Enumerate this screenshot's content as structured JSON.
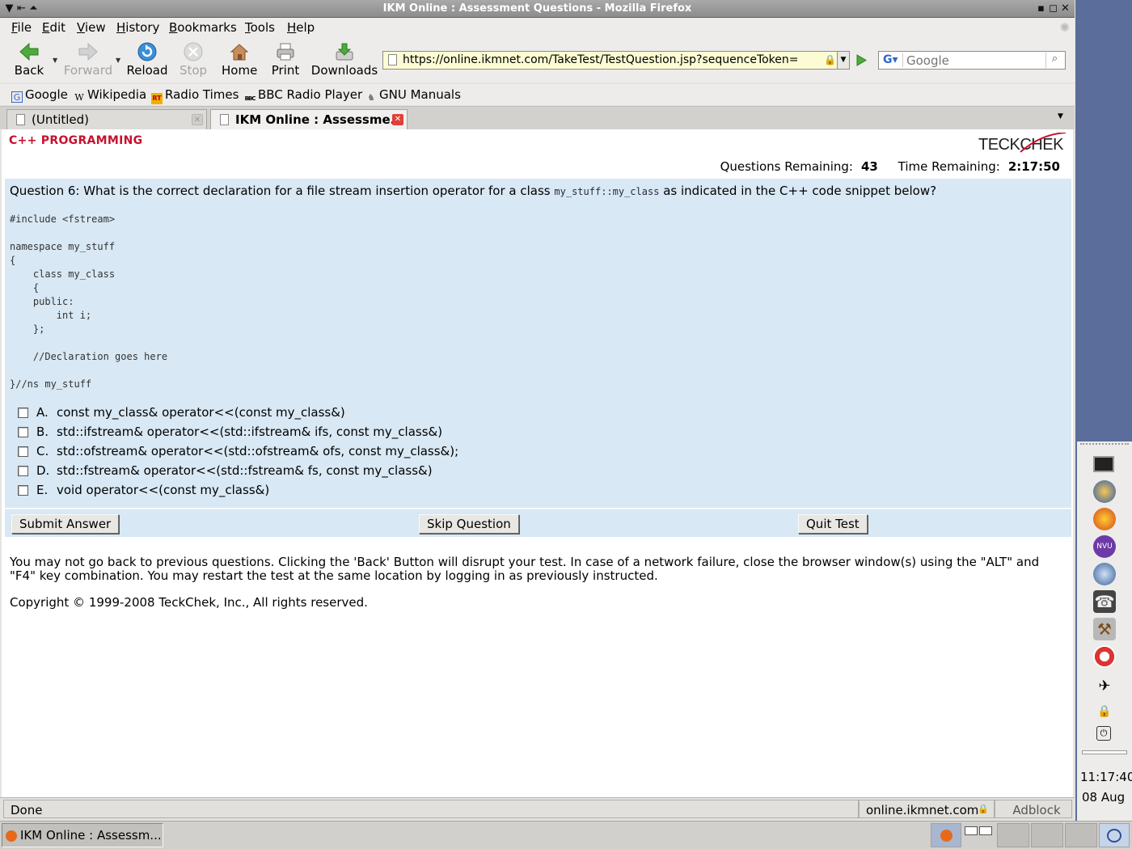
{
  "window": {
    "title": "IKM Online : Assessment Questions - Mozilla Firefox"
  },
  "menu": [
    "File",
    "Edit",
    "View",
    "History",
    "Bookmarks",
    "Tools",
    "Help"
  ],
  "toolbar": {
    "back": "Back",
    "forward": "Forward",
    "reload": "Reload",
    "stop": "Stop",
    "home": "Home",
    "print": "Print",
    "downloads": "Downloads",
    "url": "https://online.ikmnet.com/TakeTest/TestQuestion.jsp?sequenceToken=",
    "search_placeholder": "Google"
  },
  "bookmarks": [
    "Google",
    "Wikipedia",
    "Radio Times",
    "BBC Radio Player",
    "GNU Manuals"
  ],
  "tabs": [
    {
      "label": "(Untitled)",
      "active": false
    },
    {
      "label": "IKM Online : Assessme...",
      "active": true
    }
  ],
  "page": {
    "section_title": "C++ PROGRAMMING",
    "logo": "TECKCHEK",
    "questions_remaining_label": "Questions Remaining:",
    "questions_remaining": "43",
    "time_remaining_label": "Time Remaining:",
    "time_remaining": "2:17:50",
    "question_prefix": "Question 6: What is the correct declaration for a file stream insertion operator for a class",
    "question_code": "my_stuff::my_class",
    "question_suffix": "as indicated in the C++ code snippet below?",
    "code_snippet": "#include <fstream>\n\nnamespace my_stuff\n{\n    class my_class\n    {\n    public:\n        int i;\n    };\n\n    //Declaration goes here\n\n}//ns my_stuff",
    "options": [
      {
        "letter": "A.",
        "text": "const my_class& operator<<(const my_class&)"
      },
      {
        "letter": "B.",
        "text": "std::ifstream& operator<<(std::ifstream& ifs, const my_class&)"
      },
      {
        "letter": "C.",
        "text": "std::ofstream& operator<<(std::ofstream& ofs, const my_class&);"
      },
      {
        "letter": "D.",
        "text": "std::fstream& operator<<(std::fstream& fs, const my_class&)"
      },
      {
        "letter": "E.",
        "text": "void operator<<(const my_class&)"
      }
    ],
    "submit_label": "Submit Answer",
    "skip_label": "Skip Question",
    "quit_label": "Quit Test",
    "notice": "You may not go back to previous questions. Clicking the 'Back' Button will disrupt your test. In case of a network failure, close the browser window(s) using the \"ALT\" and \"F4\" key combination. You may restart the test at the same location by logging in as previously instructed.",
    "copyright": "Copyright © 1999-2008 TeckChek, Inc., All rights reserved."
  },
  "status": {
    "text": "Done",
    "host": "online.ikmnet.com",
    "adblock": "Adblock"
  },
  "taskbar": {
    "window_label": "IKM Online : Assessm..."
  },
  "clock": {
    "time": "11:17:40",
    "date": "08 Aug"
  }
}
